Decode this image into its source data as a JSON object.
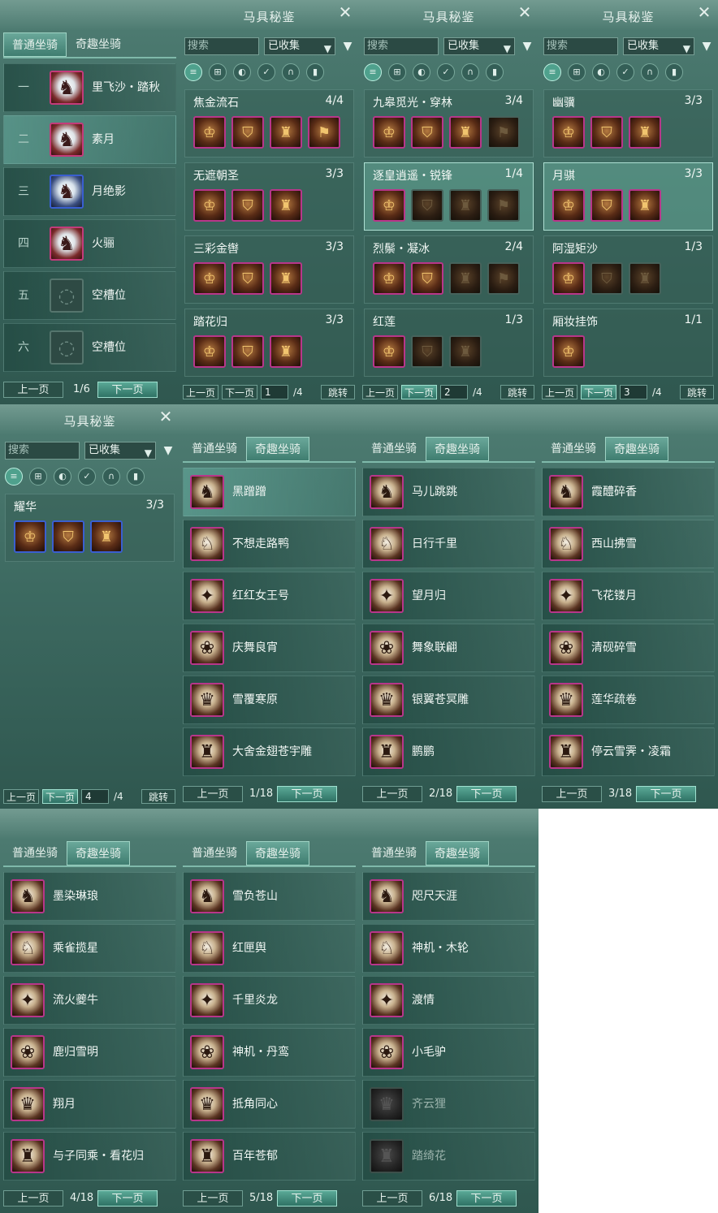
{
  "tabs": {
    "normal": "普通坐骑",
    "fun": "奇趣坐骑"
  },
  "stable": {
    "slots": [
      {
        "num": "一",
        "name": "里飞沙・踏秋",
        "state": "filled"
      },
      {
        "num": "二",
        "name": "素月",
        "state": "active"
      },
      {
        "num": "三",
        "name": "月绝影",
        "state": "filled"
      },
      {
        "num": "四",
        "name": "火骊",
        "state": "filled"
      },
      {
        "num": "五",
        "name": "空槽位",
        "state": "empty"
      },
      {
        "num": "六",
        "name": "空槽位",
        "state": "empty"
      }
    ],
    "prev": "上一页",
    "next": "下一页",
    "page": "1/6"
  },
  "book": {
    "title": "马具秘鉴",
    "close_icon": "close-icon",
    "search_placeholder": "搜索",
    "filter_value": "已收集",
    "prev": "上一页",
    "next": "下一页",
    "jump": "跳转",
    "category_icons": [
      "list-icon",
      "grid-icon",
      "saddle-icon",
      "bridle-icon",
      "stirrup-icon",
      "armor-icon"
    ],
    "pages": [
      {
        "page": "1",
        "total": "/4",
        "sets": [
          {
            "name": "焦金流石",
            "count": "4/4",
            "items": 4,
            "owned": 4
          },
          {
            "name": "无遮朝圣",
            "count": "3/3",
            "items": 3,
            "owned": 3
          },
          {
            "name": "三彩金辔",
            "count": "3/3",
            "items": 3,
            "owned": 3
          },
          {
            "name": "踏花归",
            "count": "3/3",
            "items": 3,
            "owned": 3
          }
        ]
      },
      {
        "page": "2",
        "total": "/4",
        "sets": [
          {
            "name": "九皋觅光・穿林",
            "count": "3/4",
            "items": 4,
            "owned": 3
          },
          {
            "name": "逐皇逍遥・锐锋",
            "count": "1/4",
            "items": 4,
            "owned": 1
          },
          {
            "name": "烈鬃・凝冰",
            "count": "2/4",
            "items": 4,
            "owned": 2
          },
          {
            "name": "红莲",
            "count": "1/3",
            "items": 3,
            "owned": 1
          }
        ]
      },
      {
        "page": "3",
        "total": "/4",
        "sets": [
          {
            "name": "幽骥",
            "count": "3/3",
            "items": 3,
            "owned": 3
          },
          {
            "name": "月骐",
            "count": "3/3",
            "items": 3,
            "owned": 3
          },
          {
            "name": "阿湿矩沙",
            "count": "1/3",
            "items": 3,
            "owned": 1
          },
          {
            "name": "厢妆挂饰",
            "count": "1/1",
            "items": 1,
            "owned": 1
          }
        ]
      },
      {
        "page": "4",
        "total": "/4",
        "sets": [
          {
            "name": "耀华",
            "count": "3/3",
            "items": 3,
            "owned": 3
          }
        ]
      }
    ]
  },
  "fun": {
    "prev": "上一页",
    "next": "下一页",
    "pages": [
      {
        "page": "1/18",
        "mounts": [
          "黑蹭蹭",
          "不想走路鸭",
          "红红女王号",
          "庆舞良宵",
          "雪覆寒原",
          "大舍金翅苍宇雕"
        ]
      },
      {
        "page": "2/18",
        "mounts": [
          "马儿跳跳",
          "日行千里",
          "望月归",
          "舞象联翩",
          "银翼苍冥雕",
          "鹏鹏"
        ]
      },
      {
        "page": "3/18",
        "mounts": [
          "霞醴碎香",
          "西山拂雪",
          "飞花镂月",
          "清砚碎雪",
          "莲华疏卷",
          "停云雪霁・凌霜"
        ]
      },
      {
        "page": "4/18",
        "mounts": [
          "墨染琳琅",
          "乘雀揽星",
          "流火夔牛",
          "鹿归雪明",
          "翔月",
          "与子同乘・看花归"
        ]
      },
      {
        "page": "5/18",
        "mounts": [
          "雪负苍山",
          "红匣舆",
          "千里炎龙",
          "神机・丹鸾",
          "抵角同心",
          "百年苍郁"
        ]
      },
      {
        "page": "6/18",
        "mounts": [
          "咫尺天涯",
          "神机・木轮",
          "渡情",
          "小毛驴",
          "齐云狸",
          "踏绮花"
        ]
      }
    ]
  }
}
